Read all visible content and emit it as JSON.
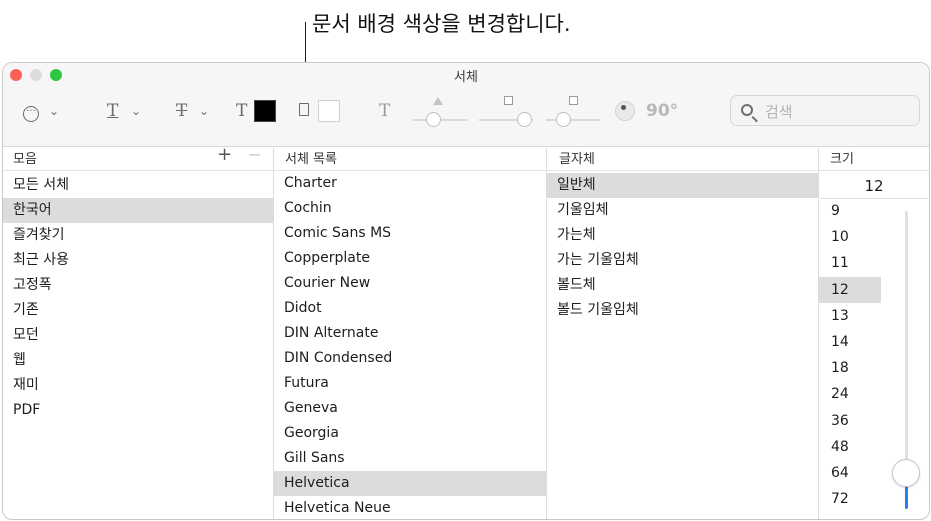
{
  "callout": {
    "text": "문서 배경 색상을 변경합니다."
  },
  "window": {
    "title": "서체"
  },
  "toolbar": {
    "more_icon": "ellipsis-circle-icon",
    "underline_glyph": "T",
    "strike_glyph": "T",
    "text_color_glyph": "T",
    "text_color": "#000000",
    "doc_color": "#ffffff",
    "shadow_glyph": "T",
    "angle_label": "90°",
    "search_placeholder": "검색",
    "search_value": ""
  },
  "columns": {
    "collections": {
      "header": "모음",
      "add": "+",
      "remove": "−"
    },
    "families": {
      "header": "서체 목록"
    },
    "typefaces": {
      "header": "글자체"
    },
    "size": {
      "header": "크기"
    }
  },
  "collections": [
    "모든 서체",
    "한국어",
    "즐겨찾기",
    "최근 사용",
    "고정폭",
    "기존",
    "모던",
    "웹",
    "재미",
    "PDF"
  ],
  "collections_selected": "한국어",
  "families": [
    "Charter",
    "Cochin",
    "Comic Sans MS",
    "Copperplate",
    "Courier New",
    "Didot",
    "DIN Alternate",
    "DIN Condensed",
    "Futura",
    "Geneva",
    "Georgia",
    "Gill Sans",
    "Helvetica",
    "Helvetica Neue"
  ],
  "families_selected": "Helvetica",
  "typefaces": [
    "일반체",
    "기울임체",
    "가는체",
    "가는 기울임체",
    "볼드체",
    "볼드 기울임체"
  ],
  "typefaces_selected": "일반체",
  "size": {
    "current": "12",
    "options": [
      "9",
      "10",
      "11",
      "12",
      "13",
      "14",
      "18",
      "24",
      "36",
      "48",
      "64",
      "72"
    ],
    "selected": "12",
    "slider_level": 0.12
  }
}
